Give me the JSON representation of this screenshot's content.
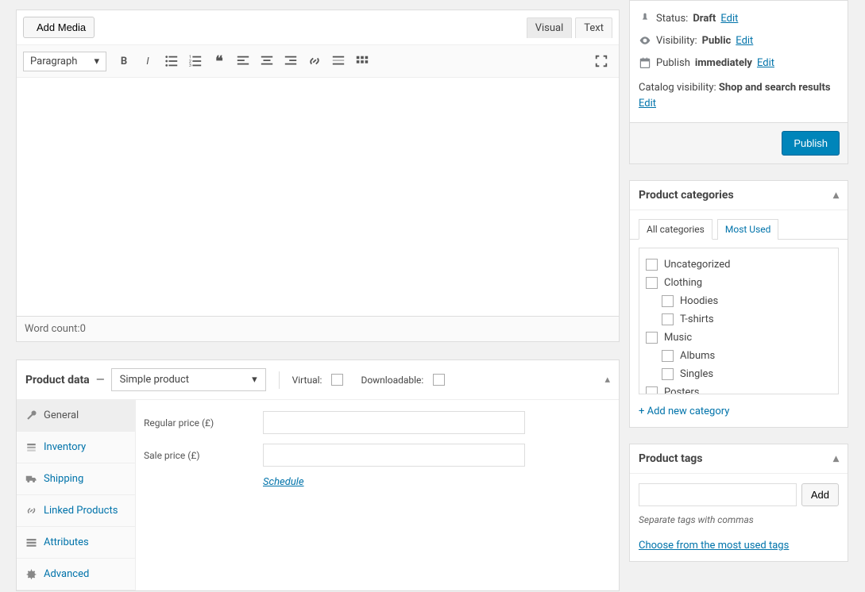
{
  "editor": {
    "add_media": "Add Media",
    "tabs": {
      "visual": "Visual",
      "text": "Text"
    },
    "paragraph_label": "Paragraph",
    "word_count_label": "Word count: ",
    "word_count": "0"
  },
  "product_data": {
    "title": "Product data",
    "dash": "—",
    "type_selected": "Simple product",
    "virtual_label": "Virtual:",
    "downloadable_label": "Downloadable:",
    "tabs": {
      "general": "General",
      "inventory": "Inventory",
      "shipping": "Shipping",
      "linked": "Linked Products",
      "attributes": "Attributes",
      "advanced": "Advanced"
    },
    "regular_price_label": "Regular price (£)",
    "sale_price_label": "Sale price (£)",
    "schedule": "Schedule"
  },
  "publish": {
    "status_label": "Status:",
    "status_value": "Draft",
    "visibility_label": "Visibility:",
    "visibility_value": "Public",
    "publish_label": "Publish",
    "publish_value": "immediately",
    "catalog_label": "Catalog visibility:",
    "catalog_value": "Shop and search results",
    "edit": "Edit",
    "publish_button": "Publish"
  },
  "categories": {
    "title": "Product categories",
    "tab_all": "All categories",
    "tab_most": "Most Used",
    "items": [
      {
        "label": "Uncategorized",
        "child": false
      },
      {
        "label": "Clothing",
        "child": false
      },
      {
        "label": "Hoodies",
        "child": true
      },
      {
        "label": "T-shirts",
        "child": true
      },
      {
        "label": "Music",
        "child": false
      },
      {
        "label": "Albums",
        "child": true
      },
      {
        "label": "Singles",
        "child": true
      },
      {
        "label": "Posters",
        "child": false
      }
    ],
    "add_new": "+ Add new category"
  },
  "tags": {
    "title": "Product tags",
    "add_button": "Add",
    "hint": "Separate tags with commas",
    "choose": "Choose from the most used tags"
  }
}
